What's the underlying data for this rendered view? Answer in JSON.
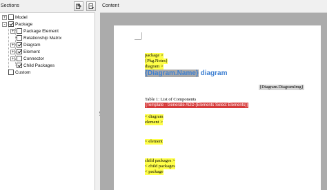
{
  "left_panel": {
    "title": "Sections",
    "buttons": [
      {
        "name": "edit-section-button",
        "icon": "edit-icon"
      },
      {
        "name": "section-options-button",
        "icon": "page-options-icon"
      }
    ],
    "tree": [
      {
        "label": "Model",
        "expander": "+",
        "checked": false,
        "level": 0
      },
      {
        "label": "Package",
        "expander": "-",
        "checked": true,
        "level": 0
      },
      {
        "label": "Package Element",
        "expander": "+",
        "checked": false,
        "level": 1
      },
      {
        "label": "Relationship Matrix",
        "expander": "",
        "checked": false,
        "level": 1
      },
      {
        "label": "Diagram",
        "expander": "+",
        "checked": true,
        "level": 1
      },
      {
        "label": "Element",
        "expander": "+",
        "checked": true,
        "level": 1
      },
      {
        "label": "Connector",
        "expander": "+",
        "checked": false,
        "level": 1
      },
      {
        "label": "Child Packages",
        "expander": "",
        "checked": true,
        "level": 1
      },
      {
        "label": "Custom",
        "expander": "",
        "checked": false,
        "level": 0
      }
    ]
  },
  "right_panel": {
    "title": "Content"
  },
  "document": {
    "package_open": "package >",
    "pkg_notes": "{Pkg.Notes}",
    "diagram_open": "diagram >",
    "diagram_title_field": "{Diagram.Name}",
    "diagram_title_suffix": " diagram",
    "diagram_img": "{Diagram.DiagramImg}",
    "table_caption": "Table 1: List of Components",
    "template_field": "{Template - Generate ADD (Elements Select Elements)}",
    "diagram_close_1": "< diagram",
    "element_open": "element >",
    "element_close": "< element",
    "child_packages_open": "child packages >",
    "child_packages_close": "< child packages",
    "package_close": "< package"
  },
  "colors": {
    "highlight": "#ffff4a",
    "title_blue": "#3d7fd1",
    "template_red": "#d63a3a",
    "workspace_gray": "#ababab"
  }
}
